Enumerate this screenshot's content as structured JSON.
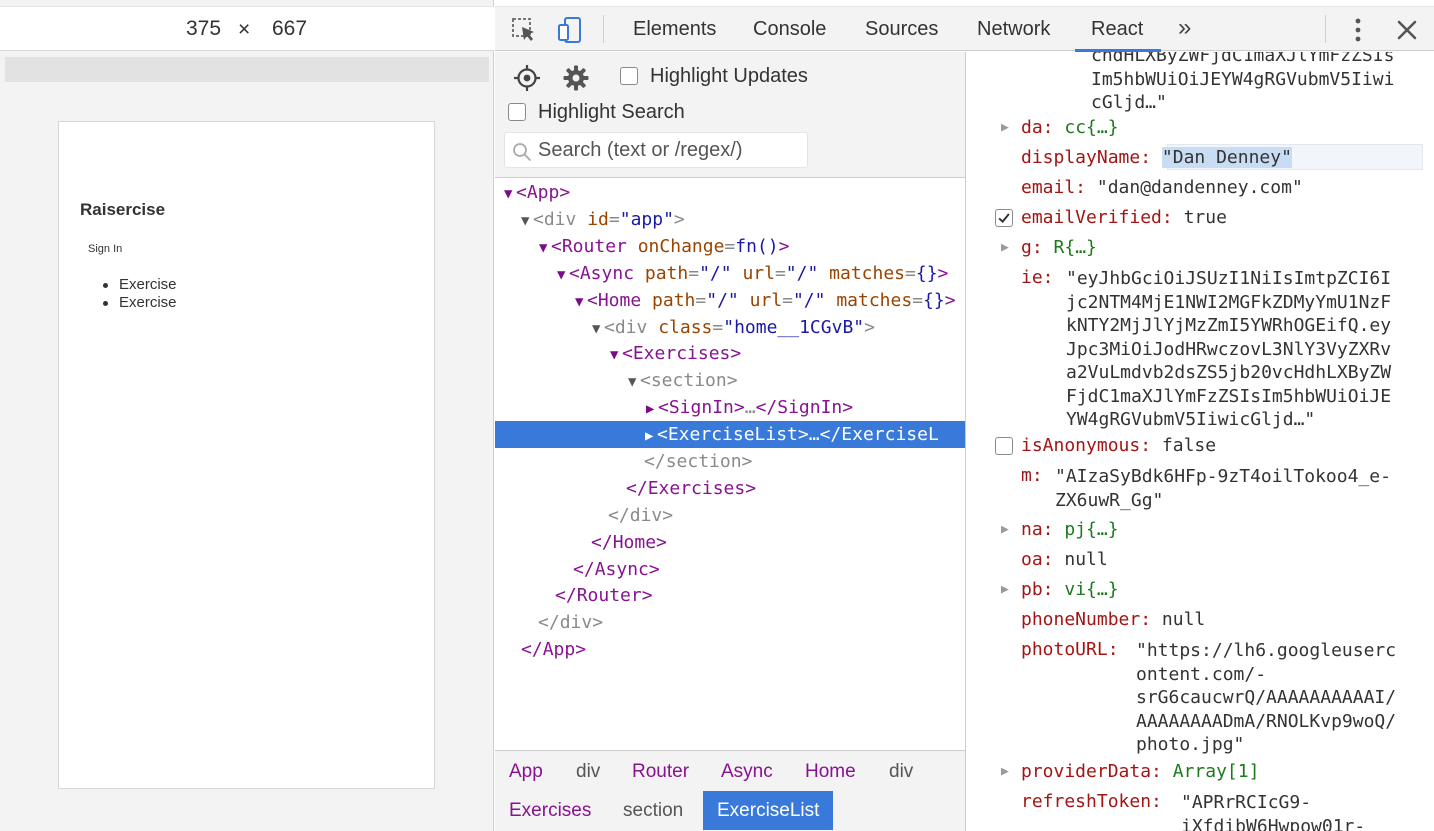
{
  "device": {
    "width": "375",
    "separator": "×",
    "height": "667"
  },
  "page": {
    "title": "Raisercise",
    "signin": "Sign In",
    "list": [
      "Exercise",
      "Exercise"
    ]
  },
  "devtools": {
    "tabs": [
      "Elements",
      "Console",
      "Sources",
      "Network",
      "React"
    ],
    "active_tab": "React",
    "more": "»",
    "icons": [
      "inspect-icon",
      "device-toggle-icon",
      "kebab-icon",
      "close-icon"
    ]
  },
  "tree_toolbar": {
    "highlight_updates": "Highlight Updates",
    "highlight_search": "Highlight Search",
    "search_placeholder": "Search (text or /regex/)"
  },
  "tree": {
    "app_open": "App",
    "div_app": {
      "tag": "div",
      "attr": "id",
      "value": "\"app\""
    },
    "router": {
      "tag": "Router",
      "attr": "onChange",
      "value": "fn()"
    },
    "async": {
      "tag": "Async",
      "a1": "path",
      "v1": "\"/\"",
      "a2": "url",
      "v2": "\"/\"",
      "a3": "matches",
      "v3": "{}"
    },
    "home": {
      "tag": "Home",
      "a1": "path",
      "v1": "\"/\"",
      "a2": "url",
      "v2": "\"/\"",
      "a3": "matches",
      "v3": "{}"
    },
    "div_home": {
      "tag": "div",
      "attr": "class",
      "value": "\"home__1CGvB\""
    },
    "exercises": "Exercises",
    "section": "section",
    "signin": "SignIn",
    "exerciselist": "ExerciseList",
    "exerciselist_close": "ExerciseL",
    "ellipsis": "…",
    "close_section": "section",
    "close_exercises": "Exercises",
    "close_div": "div",
    "close_home": "Home",
    "close_async": "Async",
    "close_router": "Router",
    "close_div2": "div",
    "close_app": "App"
  },
  "breadcrumb": {
    "row1": [
      {
        "label": "App",
        "kind": "comp"
      },
      {
        "label": "div",
        "kind": "dom"
      },
      {
        "label": "Router",
        "kind": "comp"
      },
      {
        "label": "Async",
        "kind": "comp"
      },
      {
        "label": "Home",
        "kind": "comp"
      },
      {
        "label": "div",
        "kind": "dom"
      }
    ],
    "row2": [
      {
        "label": "Exercises",
        "kind": "comp"
      },
      {
        "label": "section",
        "kind": "dom"
      },
      {
        "label": "ExerciseList",
        "kind": "active"
      }
    ]
  },
  "props": {
    "top_wrap": "chdHLXByZWFjdC1maXJlYmFzZSIs\nIm5hbWUiOiJEYW4gRGVubmV5Iiwi\ncGljd…\"",
    "da": {
      "key": "da:",
      "value": "cc{…}"
    },
    "displayName": {
      "key": "displayName:",
      "value": "\"Dan Denney\""
    },
    "email": {
      "key": "email:",
      "value": "\"dan@dandenney.com\""
    },
    "emailVerified": {
      "key": "emailVerified:",
      "value": "true"
    },
    "g": {
      "key": "g:",
      "value": "R{…}"
    },
    "ie": {
      "key": "ie:",
      "value": "\"eyJhbGciOiJSUzI1NiIsImtpZCI6I\njc2NTM4MjE1NWI2MGFkZDMyYmU1NzF\nkNTY2MjJlYjMzZmI5YWRhOGEifQ.ey\nJpc3MiOiJodHRwczovL3NlY3VyZXRv\na2VuLmdvb2dsZS5jb20vcHdhLXByZW\nFjdC1maXJlYmFzZSIsIm5hbWUiOiJE\nYW4gRGVubmV5IiwicGljd…\""
    },
    "isAnonymous": {
      "key": "isAnonymous:",
      "value": "false"
    },
    "m": {
      "key": "m:",
      "value": "\"AIzaSyBdk6HFp-9zT4oilTokoo4_e-\nZX6uwR_Gg\""
    },
    "na": {
      "key": "na:",
      "value": "pj{…}"
    },
    "oa": {
      "key": "oa:",
      "value": "null"
    },
    "pb": {
      "key": "pb:",
      "value": "vi{…}"
    },
    "phoneNumber": {
      "key": "phoneNumber:",
      "value": "null"
    },
    "photoURL": {
      "key": "photoURL:",
      "value": "\"https://lh6.googleuserc\nontent.com/-\nsrG6caucwrQ/AAAAAAAAAAI/\nAAAAAAAADmA/RNOLKvp9woQ/\nphoto.jpg\""
    },
    "providerData": {
      "key": "providerData:",
      "value": "Array[1]"
    },
    "refreshToken": {
      "key": "refreshToken:",
      "value": "\"APRrRCIcG9-\niXfdibW6Hwpow01r-"
    }
  },
  "colors": {
    "accent": "#3879d9",
    "component": "#881391",
    "attr": "#994500",
    "attr_value": "#1a1aa6",
    "prop_key": "#a31515",
    "prop_object": "#1b7a1b"
  }
}
